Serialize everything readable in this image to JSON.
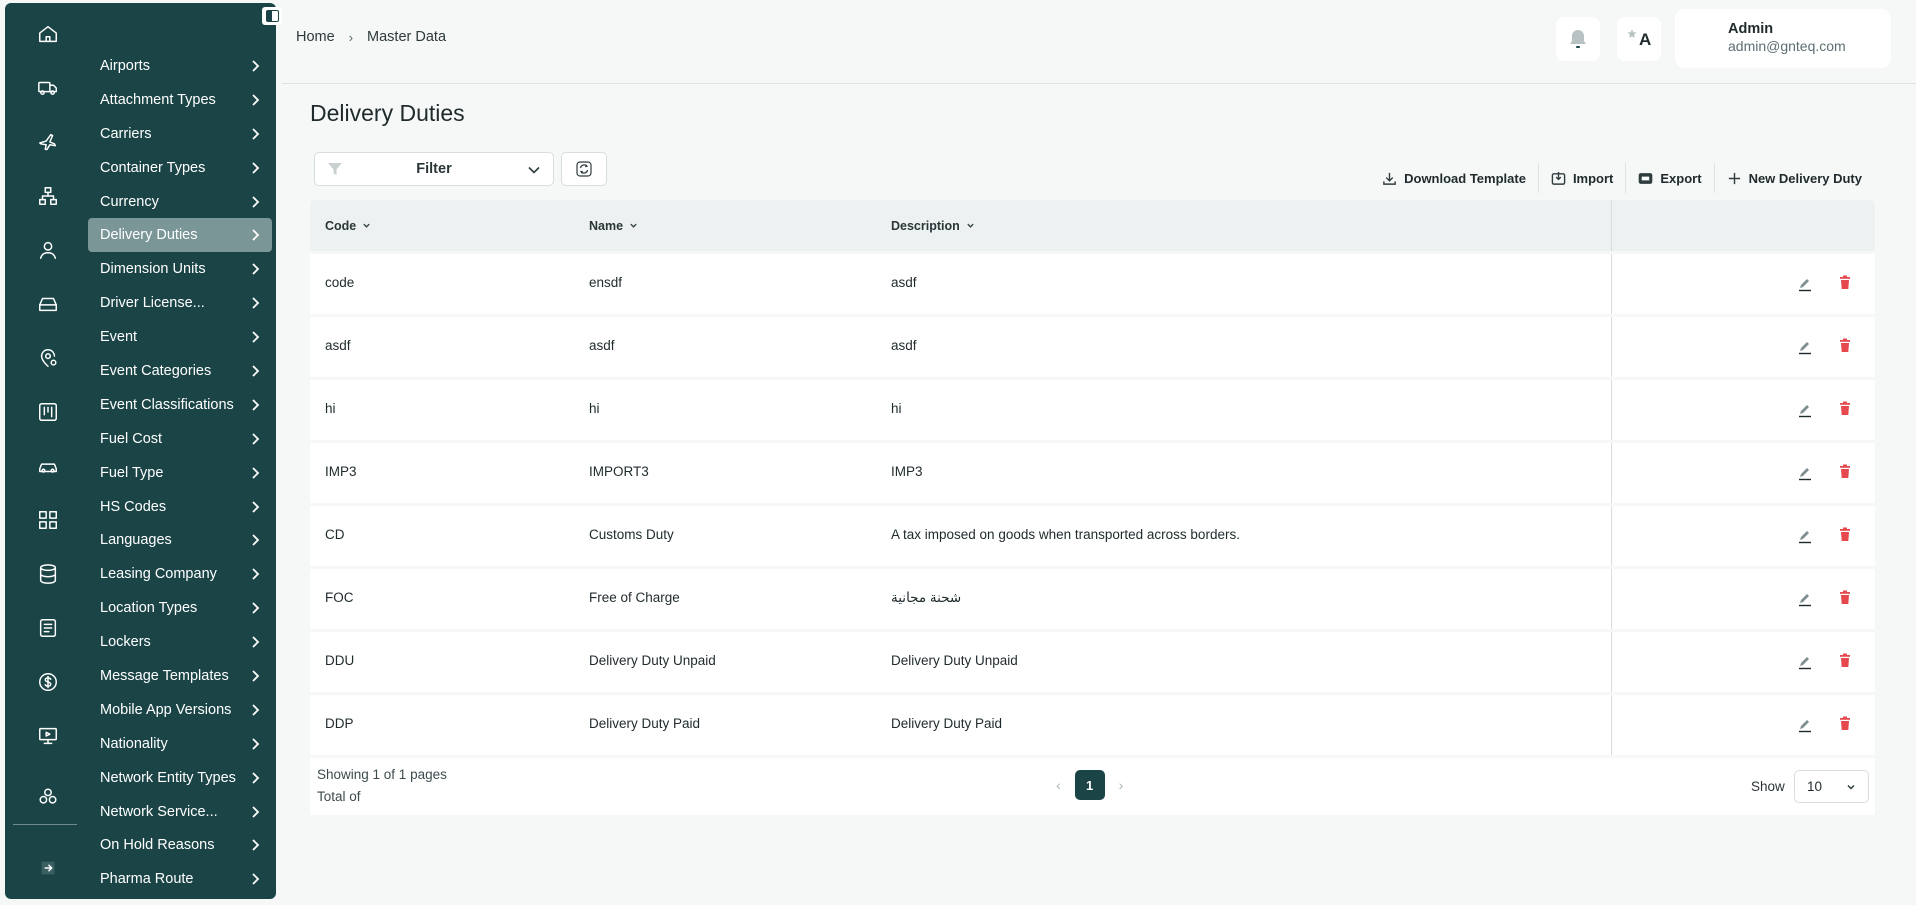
{
  "breadcrumb": {
    "home": "Home",
    "current": "Master Data"
  },
  "user": {
    "name": "Admin",
    "email": "admin@gnteq.com"
  },
  "translate_badge": "A",
  "page_title": "Delivery Duties",
  "filter": {
    "label": "Filter"
  },
  "actions": {
    "download_template": "Download Template",
    "import": "Import",
    "export": "Export",
    "new": "New Delivery Duty"
  },
  "columns": {
    "code": "Code",
    "name": "Name",
    "description": "Description"
  },
  "rows": [
    {
      "code": "code",
      "name": "ensdf",
      "description": "asdf"
    },
    {
      "code": "asdf",
      "name": "asdf",
      "description": "asdf"
    },
    {
      "code": "hi",
      "name": "hi",
      "description": "hi"
    },
    {
      "code": "IMP3",
      "name": "IMPORT3",
      "description": "IMP3"
    },
    {
      "code": "CD",
      "name": "Customs Duty",
      "description": "A tax imposed on goods when transported across borders."
    },
    {
      "code": "FOC",
      "name": "Free of Charge",
      "description": "شحنة مجانية"
    },
    {
      "code": "DDU",
      "name": "Delivery Duty Unpaid",
      "description": "Delivery Duty Unpaid"
    },
    {
      "code": "DDP",
      "name": "Delivery Duty Paid",
      "description": "Delivery Duty Paid"
    }
  ],
  "pagination": {
    "showing": "Showing 1 of 1 pages",
    "total": "Total of",
    "current_page": "1",
    "show_label": "Show",
    "page_size": "10"
  },
  "sidebar": {
    "active": "Delivery Duties",
    "items": [
      "Airports",
      "Attachment Types",
      "Carriers",
      "Container Types",
      "Currency",
      "Delivery Duties",
      "Dimension Units",
      "Driver License...",
      "Event",
      "Event Categories",
      "Event Classifications",
      "Fuel Cost",
      "Fuel Type",
      "HS Codes",
      "Languages",
      "Leasing Company",
      "Location Types",
      "Lockers",
      "Message Templates",
      "Mobile App Versions",
      "Nationality",
      "Network Entity Types",
      "Network Service...",
      "On Hold Reasons",
      "Pharma Route"
    ],
    "rail_icons": [
      "home-icon",
      "truck-icon",
      "plane-icon",
      "network-icon",
      "user-icon",
      "storage-icon",
      "location-user-icon",
      "kanban-icon",
      "car-icon",
      "grid-icon",
      "database-icon",
      "document-list-icon",
      "dollar-icon",
      "presentation-icon",
      "cluster-icon"
    ]
  },
  "colors": {
    "sidebar": "#1b4446",
    "active_item": "#7b9697",
    "delete": "#e5484d"
  }
}
